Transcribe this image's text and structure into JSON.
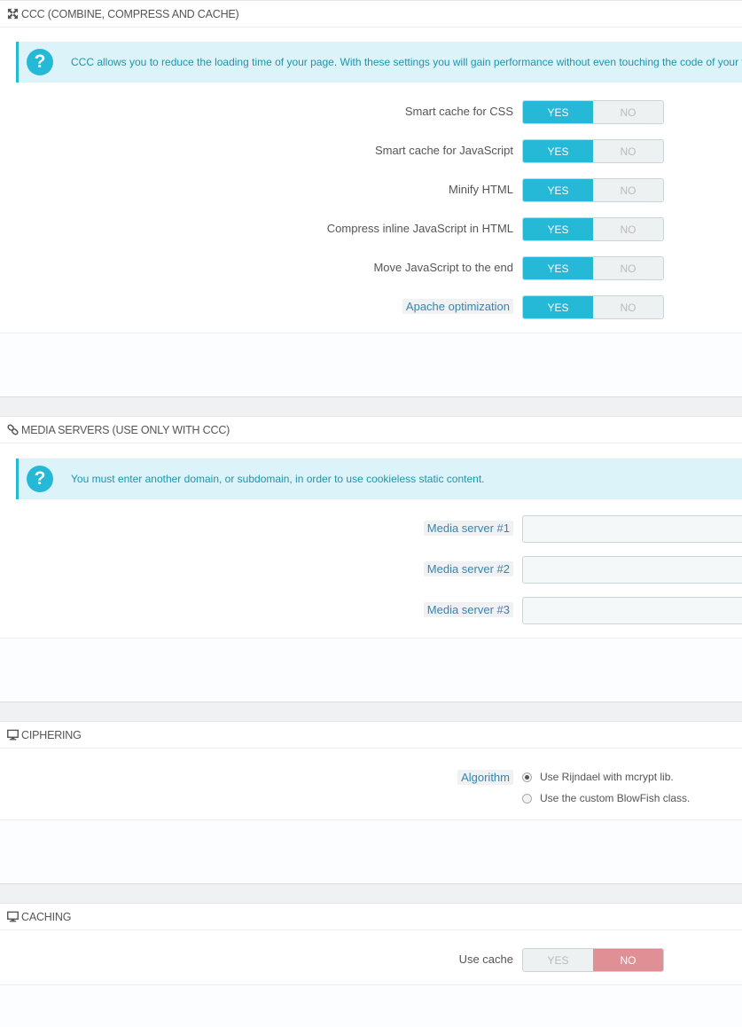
{
  "ccc": {
    "title": "CCC (COMBINE, COMPRESS AND CACHE)",
    "alert": "CCC allows you to reduce the loading time of your page. With these settings you will gain performance without even touching the code of your theme. Make sure, however, that your theme is compatible with PrestaShop 1.4+. Otherwise, CCC will cause problems.",
    "options": [
      {
        "label": "Smart cache for CSS",
        "yes": "YES",
        "no": "NO",
        "value": "yes",
        "help": false
      },
      {
        "label": "Smart cache for JavaScript",
        "yes": "YES",
        "no": "NO",
        "value": "yes",
        "help": false
      },
      {
        "label": "Minify HTML",
        "yes": "YES",
        "no": "NO",
        "value": "yes",
        "help": false
      },
      {
        "label": "Compress inline JavaScript in HTML",
        "yes": "YES",
        "no": "NO",
        "value": "yes",
        "help": false
      },
      {
        "label": "Move JavaScript to the end",
        "yes": "YES",
        "no": "NO",
        "value": "yes",
        "help": false
      },
      {
        "label": "Apache optimization",
        "yes": "YES",
        "no": "NO",
        "value": "yes",
        "help": true
      }
    ]
  },
  "media": {
    "title": "MEDIA SERVERS (USE ONLY WITH CCC)",
    "alert": "You must enter another domain, or subdomain, in order to use cookieless static content.",
    "servers": [
      {
        "label": "Media server #1",
        "value": ""
      },
      {
        "label": "Media server #2",
        "value": ""
      },
      {
        "label": "Media server #3",
        "value": ""
      }
    ]
  },
  "ciphering": {
    "title": "CIPHERING",
    "label": "Algorithm",
    "options": [
      {
        "label": "Use Rijndael with mcrypt lib.",
        "checked": true
      },
      {
        "label": "Use the custom BlowFish class.",
        "checked": false
      }
    ]
  },
  "caching": {
    "title": "CACHING",
    "label": "Use cache",
    "yes": "YES",
    "no": "NO",
    "value": "no"
  },
  "colors": {
    "accent": "#25b9d7",
    "danger": "#e08f95",
    "alert_bg": "#dcf4f9"
  }
}
